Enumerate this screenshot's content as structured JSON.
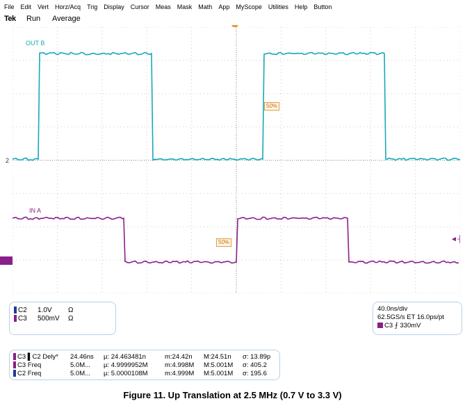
{
  "menu": [
    {
      "label": "File"
    },
    {
      "label": "Edit"
    },
    {
      "label": "Vert"
    },
    {
      "label": "Horz/Acq"
    },
    {
      "label": "Trig"
    },
    {
      "label": "Display"
    },
    {
      "label": "Cursor"
    },
    {
      "label": "Meas"
    },
    {
      "label": "Mask"
    },
    {
      "label": "Math"
    },
    {
      "label": "App"
    },
    {
      "label": "MyScope"
    },
    {
      "label": "Utilities"
    },
    {
      "label": "Help"
    },
    {
      "label": "Button"
    }
  ],
  "status": {
    "brand": "Tek",
    "run": "Run",
    "mode": "Average"
  },
  "screen": {
    "trace_labels": {
      "out_b": "OUT B",
      "in_a": "IN A"
    },
    "ref_marker": "2",
    "pct_tag_1": "50%",
    "pct_tag_2": "50%",
    "colors": {
      "out_b": "#17a8b8",
      "in_a": "#8a1f8a",
      "grid": "#c8c8c8",
      "trigger": "#e29a3b"
    }
  },
  "scale_panel": {
    "rows": [
      {
        "ch": "C2",
        "val": "1.0V",
        "unit": "Ω"
      },
      {
        "ch": "C3",
        "val": "500mV",
        "unit": "Ω"
      }
    ]
  },
  "timebase_panel": {
    "line1": "40.0ns/div",
    "line2": "62.5GS/s ET 16.0ps/pt",
    "trigger": "C3 ⨍ 330mV"
  },
  "meas_panel": {
    "rows": [
      {
        "label": "C3 ▌C2 Dely*",
        "value": "24.46ns",
        "mean": "µ: 24.463481n",
        "min": "m:24.42n",
        "max": "M:24.51n",
        "sigma": "σ: 13.89p"
      },
      {
        "label": "C3 Freq",
        "value": "5.0M...",
        "mean": "µ: 4.9999952M",
        "min": "m:4.998M",
        "max": "M:5.001M",
        "sigma": "σ: 405.2"
      },
      {
        "label": "C2 Freq",
        "value": "5.0M...",
        "mean": "µ: 5.0000108M",
        "min": "m:4.999M",
        "max": "M:5.001M",
        "sigma": "σ: 195.6"
      }
    ]
  },
  "caption": "Figure 11.  Up Translation at 2.5 MHz (0.7 V to 3.3 V)"
}
